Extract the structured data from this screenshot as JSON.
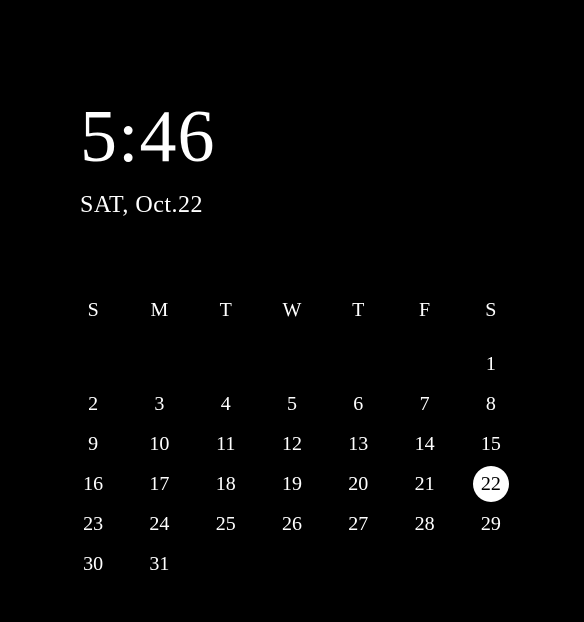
{
  "clock": {
    "time": "5:46",
    "date": "SAT, Oct.22"
  },
  "calendar": {
    "headers": [
      "S",
      "M",
      "T",
      "W",
      "T",
      "F",
      "S"
    ],
    "today": 22,
    "weeks": [
      [
        "",
        "",
        "",
        "",
        "",
        "",
        "1"
      ],
      [
        "2",
        "3",
        "4",
        "5",
        "6",
        "7",
        "8"
      ],
      [
        "9",
        "10",
        "11",
        "12",
        "13",
        "14",
        "15"
      ],
      [
        "16",
        "17",
        "18",
        "19",
        "20",
        "21",
        "22"
      ],
      [
        "23",
        "24",
        "25",
        "26",
        "27",
        "28",
        "29"
      ],
      [
        "30",
        "31",
        "",
        "",
        "",
        "",
        ""
      ]
    ]
  }
}
